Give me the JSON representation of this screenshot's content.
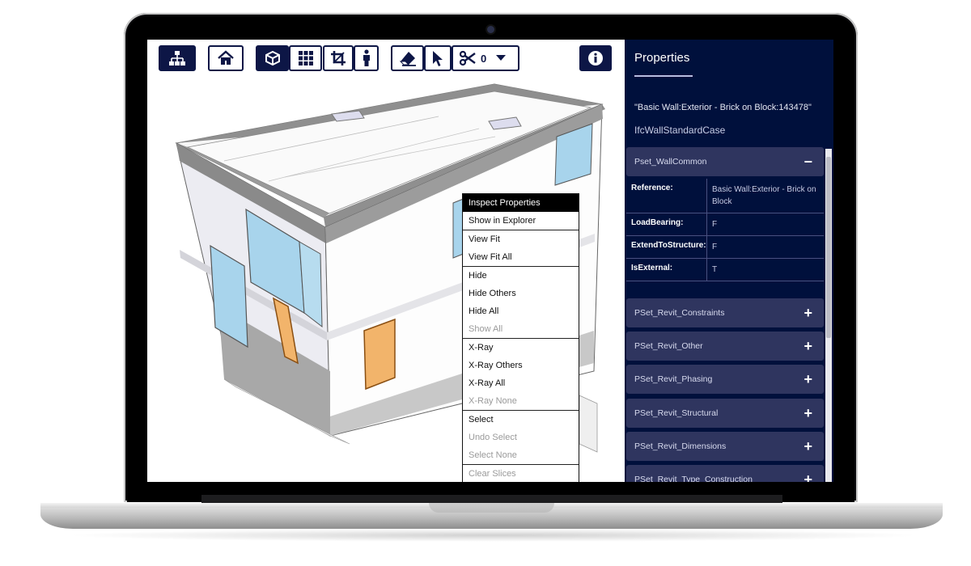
{
  "toolbar": {
    "buttons": [
      {
        "name": "explorer-button",
        "icon": "sitemap-icon"
      },
      {
        "name": "home-button",
        "icon": "home-icon"
      },
      {
        "name": "ortho-button",
        "icon": "cube-icon"
      },
      {
        "name": "grid-button",
        "icon": "grid-icon"
      },
      {
        "name": "crop-button",
        "icon": "crop-icon"
      },
      {
        "name": "person-button",
        "icon": "person-icon"
      },
      {
        "name": "erase-button",
        "icon": "eraser-icon"
      },
      {
        "name": "select-button",
        "icon": "cursor-icon"
      },
      {
        "name": "slice-button",
        "icon": "scissors-icon"
      }
    ],
    "slice_count": "0",
    "info_icon": "info-icon"
  },
  "context_menu": {
    "items": [
      {
        "label": "Inspect Properties",
        "state": "highlighted"
      },
      {
        "label": "Show in Explorer",
        "state": "normal"
      },
      {
        "label": "View Fit",
        "state": "normal"
      },
      {
        "label": "View Fit All",
        "state": "normal"
      },
      {
        "label": "Hide",
        "state": "normal"
      },
      {
        "label": "Hide Others",
        "state": "normal"
      },
      {
        "label": "Hide All",
        "state": "normal"
      },
      {
        "label": "Show All",
        "state": "disabled"
      },
      {
        "label": "X-Ray",
        "state": "normal"
      },
      {
        "label": "X-Ray Others",
        "state": "normal"
      },
      {
        "label": "X-Ray All",
        "state": "normal"
      },
      {
        "label": "X-Ray None",
        "state": "disabled"
      },
      {
        "label": "Select",
        "state": "normal"
      },
      {
        "label": "Undo Select",
        "state": "disabled"
      },
      {
        "label": "Select None",
        "state": "disabled"
      },
      {
        "label": "Clear Slices",
        "state": "disabled"
      }
    ]
  },
  "properties": {
    "title": "Properties",
    "object_name": "\"Basic Wall:Exterior - Brick on Block:143478\"",
    "object_type": "IfcWallStandardCase",
    "expanded_pset": {
      "label": "Pset_WallCommon",
      "sign": "−",
      "rows": [
        {
          "key": "Reference:",
          "value": "Basic Wall:Exterior - Brick on Block"
        },
        {
          "key": "LoadBearing:",
          "value": "F"
        },
        {
          "key": "ExtendToStructure:",
          "value": "F"
        },
        {
          "key": "IsExternal:",
          "value": "T"
        }
      ]
    },
    "collapsed_psets": [
      {
        "label": "PSet_Revit_Constraints",
        "sign": "+"
      },
      {
        "label": "PSet_Revit_Other",
        "sign": "+"
      },
      {
        "label": "PSet_Revit_Phasing",
        "sign": "+"
      },
      {
        "label": "PSet_Revit_Structural",
        "sign": "+"
      },
      {
        "label": "PSet_Revit_Dimensions",
        "sign": "+"
      },
      {
        "label": "PSet_Revit_Type_Construction",
        "sign": "+"
      }
    ]
  },
  "colors": {
    "panel_bg": "#00103c",
    "pset_bg": "#2f355f",
    "accent": "#0d1646",
    "door": "#f2b46b",
    "glass": "#a8d4ec"
  }
}
